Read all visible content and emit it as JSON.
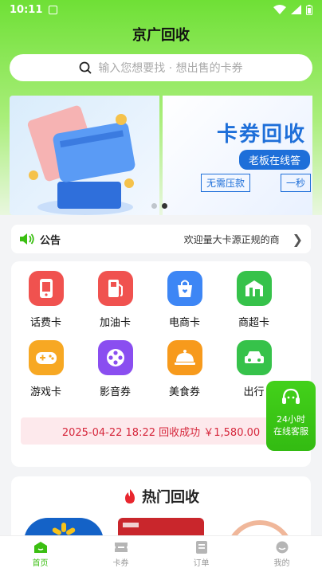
{
  "status_bar": {
    "time": "10:11"
  },
  "header": {
    "title": "京广回收"
  },
  "search": {
    "placeholder": "输入您想要找 · 想出售的卡券"
  },
  "banner": {
    "slide2": {
      "headline": "卡券回收",
      "pill": "老板在线答",
      "chip1": "无需压款",
      "chip2": "一秒"
    },
    "active_index": 1
  },
  "notice": {
    "label": "公告",
    "text": "欢迎量大卡源正规的商"
  },
  "categories": [
    {
      "label": "话费卡",
      "icon": "phone-icon",
      "color": "#f0524f"
    },
    {
      "label": "加油卡",
      "icon": "fuel-icon",
      "color": "#f0524f"
    },
    {
      "label": "电商卡",
      "icon": "shopping-bag-icon",
      "color": "#3d86f5"
    },
    {
      "label": "商超卡",
      "icon": "store-icon",
      "color": "#36c24a"
    },
    {
      "label": "游戏卡",
      "icon": "gamepad-icon",
      "color": "#f7a823"
    },
    {
      "label": "影音券",
      "icon": "film-reel-icon",
      "color": "#8a4ef0"
    },
    {
      "label": "美食券",
      "icon": "food-cloche-icon",
      "color": "#f79a1c"
    },
    {
      "label": "出行",
      "icon": "car-icon",
      "color": "#36c24a"
    }
  ],
  "ticker": {
    "text": "2025-04-22 18:22 回收成功 ￥1,580.00"
  },
  "service": {
    "line1": "24小时",
    "line2": "在线客服"
  },
  "hot": {
    "title": "热门回收"
  },
  "tabbar": [
    {
      "label": "首页",
      "icon": "home-icon",
      "active": true
    },
    {
      "label": "卡券",
      "icon": "ticket-icon",
      "active": false
    },
    {
      "label": "订单",
      "icon": "order-icon",
      "active": false
    },
    {
      "label": "我的",
      "icon": "profile-icon",
      "active": false
    }
  ],
  "colors": {
    "brand": "#3bbf12",
    "ticker_text": "#d6273c"
  }
}
